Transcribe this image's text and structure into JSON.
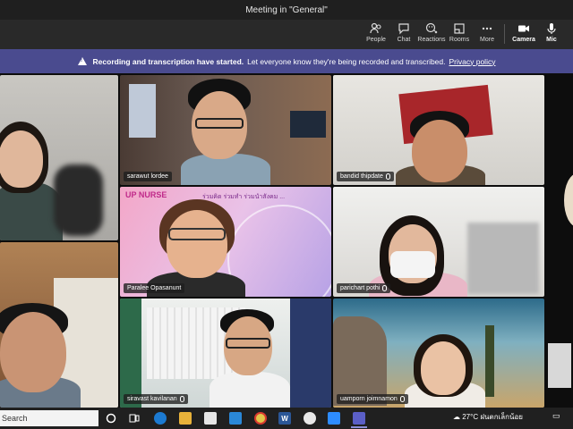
{
  "window": {
    "title": "Meeting in \"General\""
  },
  "toolbar": {
    "people": "People",
    "chat": "Chat",
    "reactions": "Reactions",
    "rooms": "Rooms",
    "more": "More",
    "camera": "Camera",
    "mic": "Mic"
  },
  "banner": {
    "bold": "Recording and transcription have started.",
    "text": "Let everyone know they're being recorded and transcribed.",
    "link": "Privacy policy"
  },
  "participants": {
    "p2": "sarawut lordee",
    "p3": "bandid thipdate",
    "p5": "Paralee Opasanunt",
    "p6": "parichart pothi",
    "p8": "siravast kavilanan",
    "p9": "uamporn joimnamon"
  },
  "slide": {
    "heading": "UP NURSE",
    "thai": "ร่วมคิด ร่วมทำ ร่วมนำสังคม ..."
  },
  "taskbar": {
    "search": "Search",
    "word_label": "W",
    "temperature": "27°C",
    "weather": "ฝนตกเล็กน้อย"
  },
  "colors": {
    "banner": "#4a4b8f",
    "toolbar": "#292929",
    "accent": "#6264a7"
  }
}
